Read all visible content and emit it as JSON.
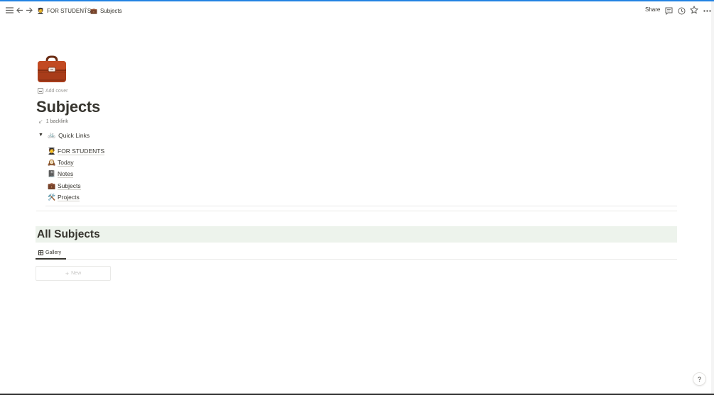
{
  "topbar": {
    "menu_icon": "hamburger-icon",
    "back_icon": "arrow-left-icon",
    "forward_icon": "arrow-right-icon",
    "breadcrumbs": [
      {
        "emoji": "🧑‍🎓",
        "label": "FOR STUDENTS"
      },
      {
        "emoji": "💼",
        "label": "Subjects"
      }
    ],
    "separator": "/",
    "share_label": "Share",
    "comment_icon": "comment-icon",
    "updates_icon": "clock-icon",
    "favorite_icon": "star-icon",
    "more_icon": "more-horizontal-icon"
  },
  "page": {
    "icon": "briefcase-icon",
    "add_cover_label": "Add cover",
    "title": "Subjects",
    "backlinks_label": "1 backlink"
  },
  "quick_links": {
    "toggle_emoji": "🚲",
    "toggle_label": "Quick Links",
    "items": [
      {
        "emoji": "🧑‍🎓",
        "label": "FOR STUDENTS"
      },
      {
        "emoji": "🕰️",
        "label": "Today"
      },
      {
        "emoji": "📓",
        "label": "Notes"
      },
      {
        "emoji": "💼",
        "label": "Subjects"
      },
      {
        "emoji": "🛠️",
        "label": "Projects"
      }
    ]
  },
  "database": {
    "title": "All Subjects",
    "view_tab": "Gallery",
    "new_label": "New",
    "header_bg": "#edf3ec"
  },
  "help_label": "?",
  "colors": {
    "accent": "#2383e2",
    "text": "#37352f",
    "muted": "#9b9a97"
  }
}
